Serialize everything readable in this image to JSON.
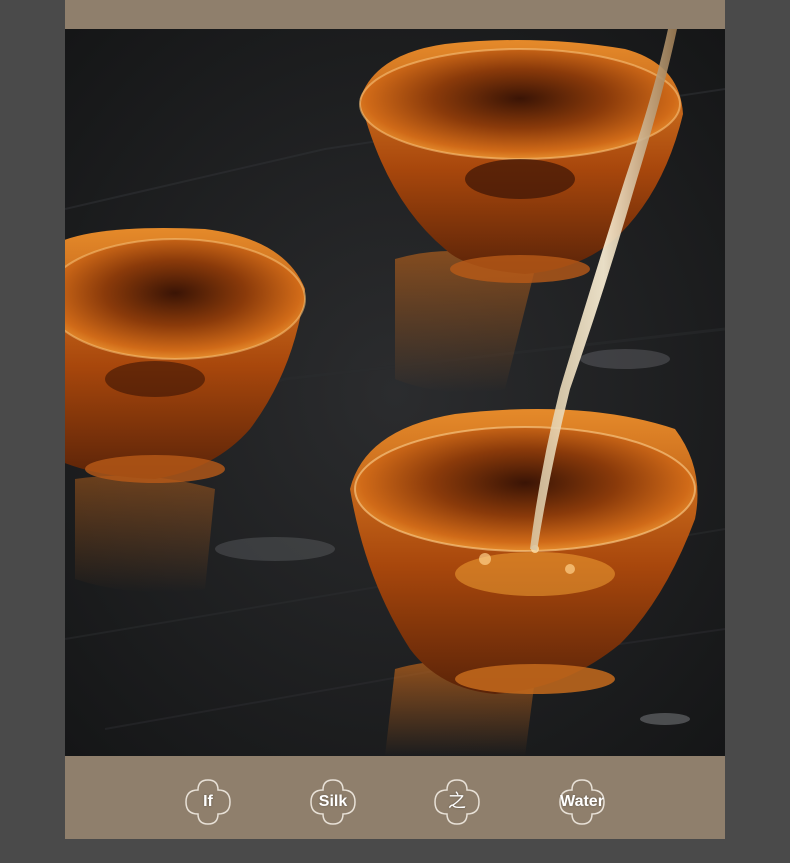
{
  "image": {
    "alt_subject": "tea-pouring-glass-cups",
    "colors": {
      "frame_background": "#4a4a4a",
      "band": "#8f7f6c",
      "slate": "#1d1e20",
      "tea": "#b8530f",
      "tea_highlight": "#f0a035"
    }
  },
  "footer": {
    "badges": [
      {
        "label": "If"
      },
      {
        "label": "Silk"
      },
      {
        "label": "之"
      },
      {
        "label": "Water"
      }
    ]
  }
}
